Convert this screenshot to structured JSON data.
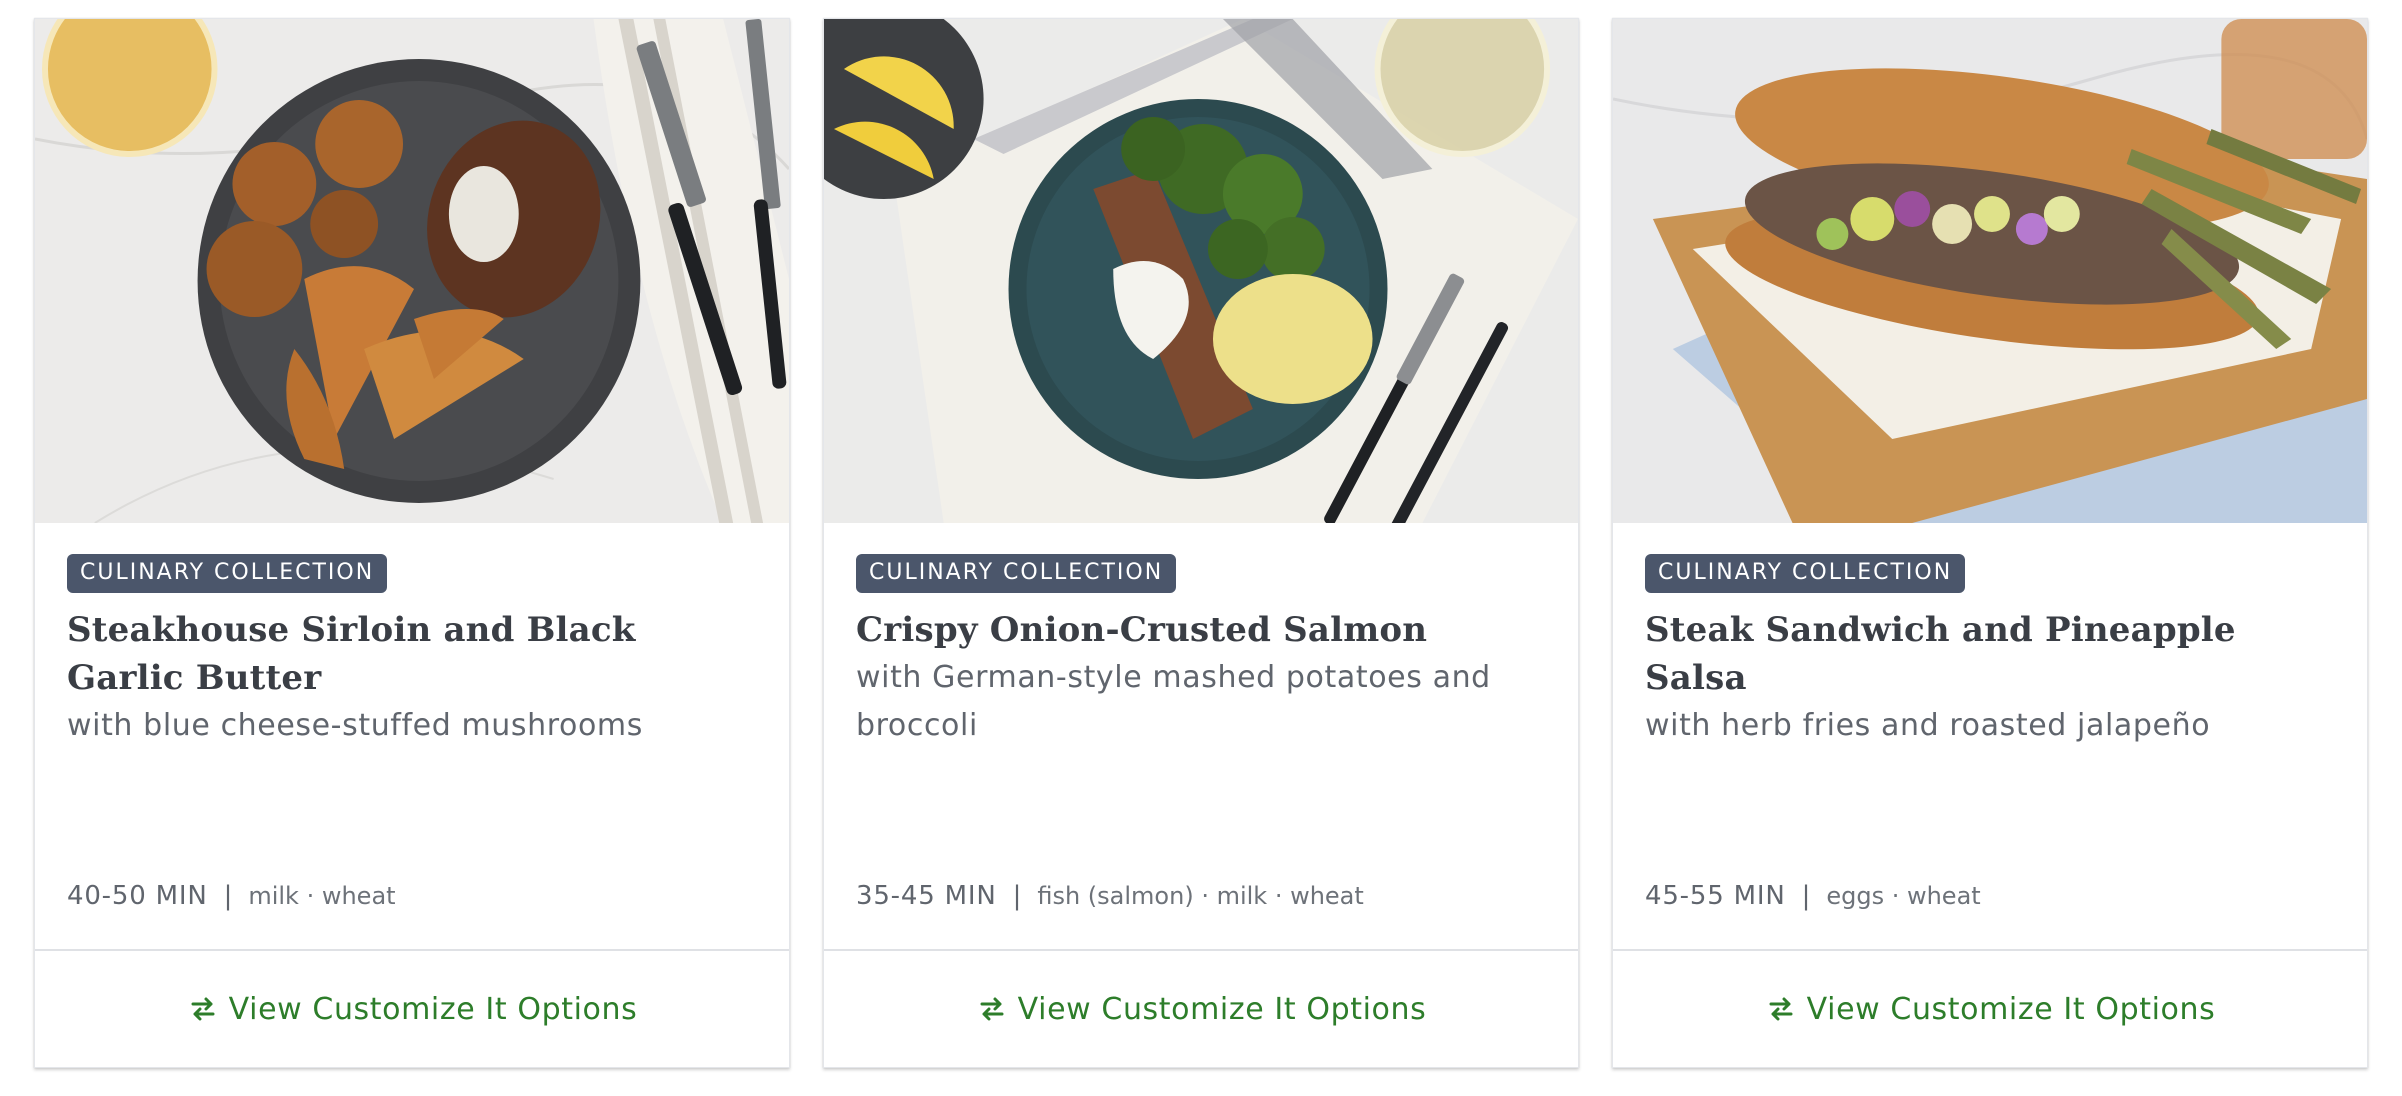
{
  "cards": [
    {
      "badge": "CULINARY COLLECTION",
      "title": "Steakhouse Sirloin and Black Garlic Butter",
      "subtitle": "with blue cheese-stuffed mushrooms",
      "time": "40-50 MIN",
      "separator": "|",
      "allergens": "milk · wheat",
      "cta": "View Customize It Options",
      "image": "steak-plate-photo"
    },
    {
      "badge": "CULINARY COLLECTION",
      "title": "Crispy Onion-Crusted Salmon",
      "subtitle": "with German-style mashed potatoes and broccoli",
      "time": "35-45 MIN",
      "separator": "|",
      "allergens": "fish (salmon) · milk · wheat",
      "cta": "View Customize It Options",
      "image": "salmon-plate-photo"
    },
    {
      "badge": "CULINARY COLLECTION",
      "title": "Steak Sandwich and Pineapple Salsa",
      "subtitle": "with herb fries and roasted jalapeño",
      "time": "45-55 MIN",
      "separator": "|",
      "allergens": "eggs · wheat",
      "cta": "View Customize It Options",
      "image": "sandwich-board-photo"
    }
  ],
  "colors": {
    "badge_bg": "#4b566b",
    "cta_green": "#2d7d2a",
    "title_text": "#3a3e45",
    "muted_text": "#60656d"
  },
  "icons": {
    "cta": "swap-arrows-icon"
  }
}
